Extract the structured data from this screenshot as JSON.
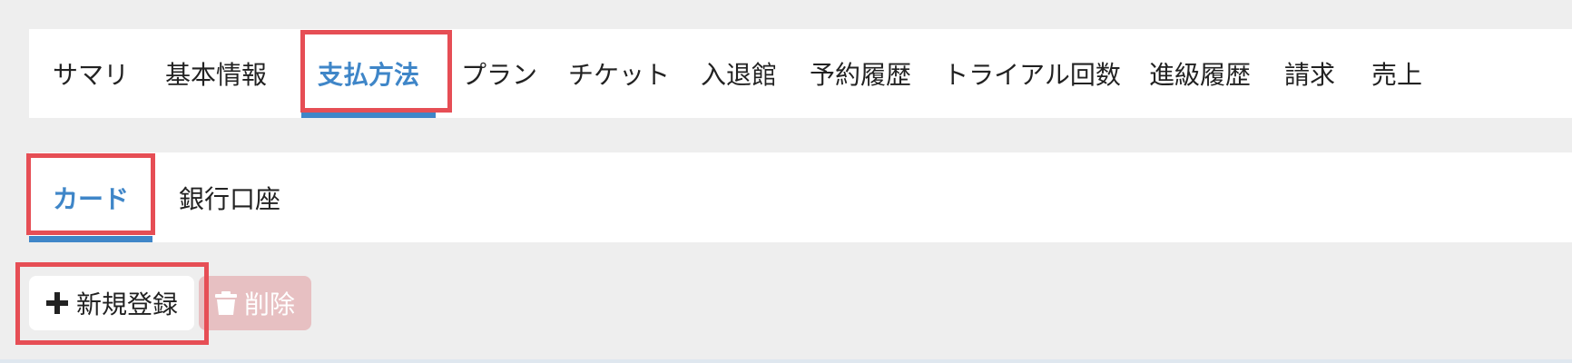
{
  "tabs": [
    {
      "label": "サマリ",
      "active": false
    },
    {
      "label": "基本情報",
      "active": false
    },
    {
      "label": "支払方法",
      "active": true
    },
    {
      "label": "プラン",
      "active": false
    },
    {
      "label": "チケット",
      "active": false
    },
    {
      "label": "入退館",
      "active": false
    },
    {
      "label": "予約履歴",
      "active": false
    },
    {
      "label": "トライアル回数",
      "active": false
    },
    {
      "label": "進級履歴",
      "active": false
    },
    {
      "label": "請求",
      "active": false
    },
    {
      "label": "売上",
      "active": false
    }
  ],
  "subtabs": [
    {
      "label": "カード",
      "active": true
    },
    {
      "label": "銀行口座",
      "active": false
    }
  ],
  "actions": {
    "new_label": "新規登録",
    "new_icon": "plus-icon",
    "delete_label": "削除",
    "delete_icon": "trash-icon",
    "delete_disabled": true
  },
  "colors": {
    "accent": "#3f86c8",
    "highlight": "#e64e55",
    "delete_disabled_bg": "#e7c0c2"
  }
}
